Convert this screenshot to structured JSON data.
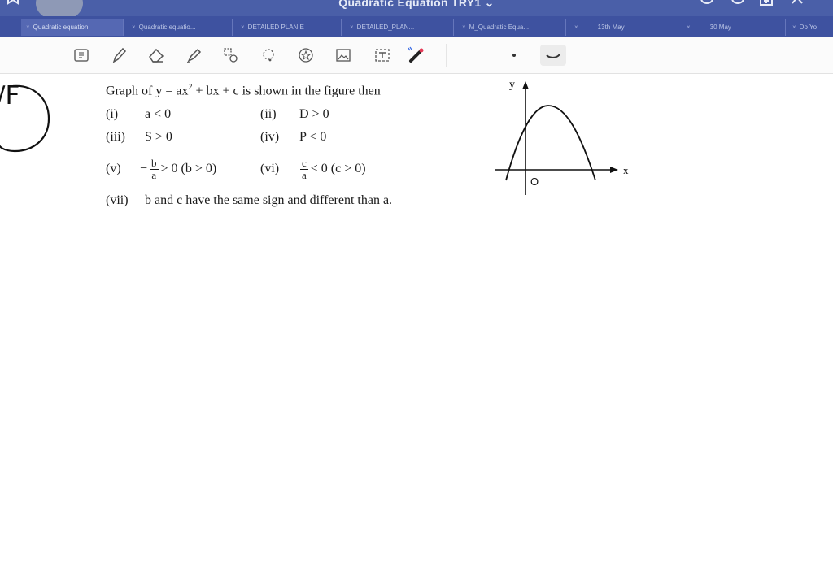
{
  "window": {
    "title": "Quadratic Equation TRY1",
    "title_chevron": "⌄",
    "colors": {
      "titlebar": "#4a5fa8",
      "tabbar": "#3e52a0"
    }
  },
  "tabs": [
    {
      "label": "Quadratic equation",
      "active": true
    },
    {
      "label": "Quadratic equatio..."
    },
    {
      "label": "DETAILED PLAN E"
    },
    {
      "label": "DETAILED_PLAN..."
    },
    {
      "label": "M_Quadratic Equa..."
    },
    {
      "label": "13th May"
    },
    {
      "label": "30 May"
    },
    {
      "label": "Do Yo"
    }
  ],
  "toolbar": {
    "tools": [
      "page-icon",
      "pen-icon",
      "eraser-icon",
      "highlighter-icon",
      "lasso-icon",
      "shapes-icon",
      "sticker-icon",
      "image-icon",
      "text-box-icon",
      "laser-pointer-icon"
    ],
    "active_pen": "dot-pen-icon"
  },
  "annotation": {
    "label": "/F"
  },
  "question": {
    "stem_a": "Graph of y = ax",
    "stem_sup": "2",
    "stem_b": " + bx + c is shown in the figure then",
    "options": {
      "i": {
        "num": "(i)",
        "text": "a < 0"
      },
      "ii": {
        "num": "(ii)",
        "text": "D > 0"
      },
      "iii": {
        "num": "(iii)",
        "text": "S > 0"
      },
      "iv": {
        "num": "(iv)",
        "text": "P < 0"
      },
      "v": {
        "num": "(v)",
        "prefix": "−",
        "frac_top": "b",
        "frac_bot": "a",
        "suffix": "> 0 (b > 0)"
      },
      "vi": {
        "num": "(vi)",
        "frac_top": "c",
        "frac_bot": "a",
        "suffix": "< 0 (c > 0)"
      },
      "vii": {
        "num": "(vii)",
        "text": "b and c have the same sign and different than a."
      }
    }
  },
  "figure": {
    "y_label": "y",
    "x_label": "x",
    "origin_label": "O",
    "curve": "downward parabola, vertex right of y-axis, positive y-intercept"
  }
}
